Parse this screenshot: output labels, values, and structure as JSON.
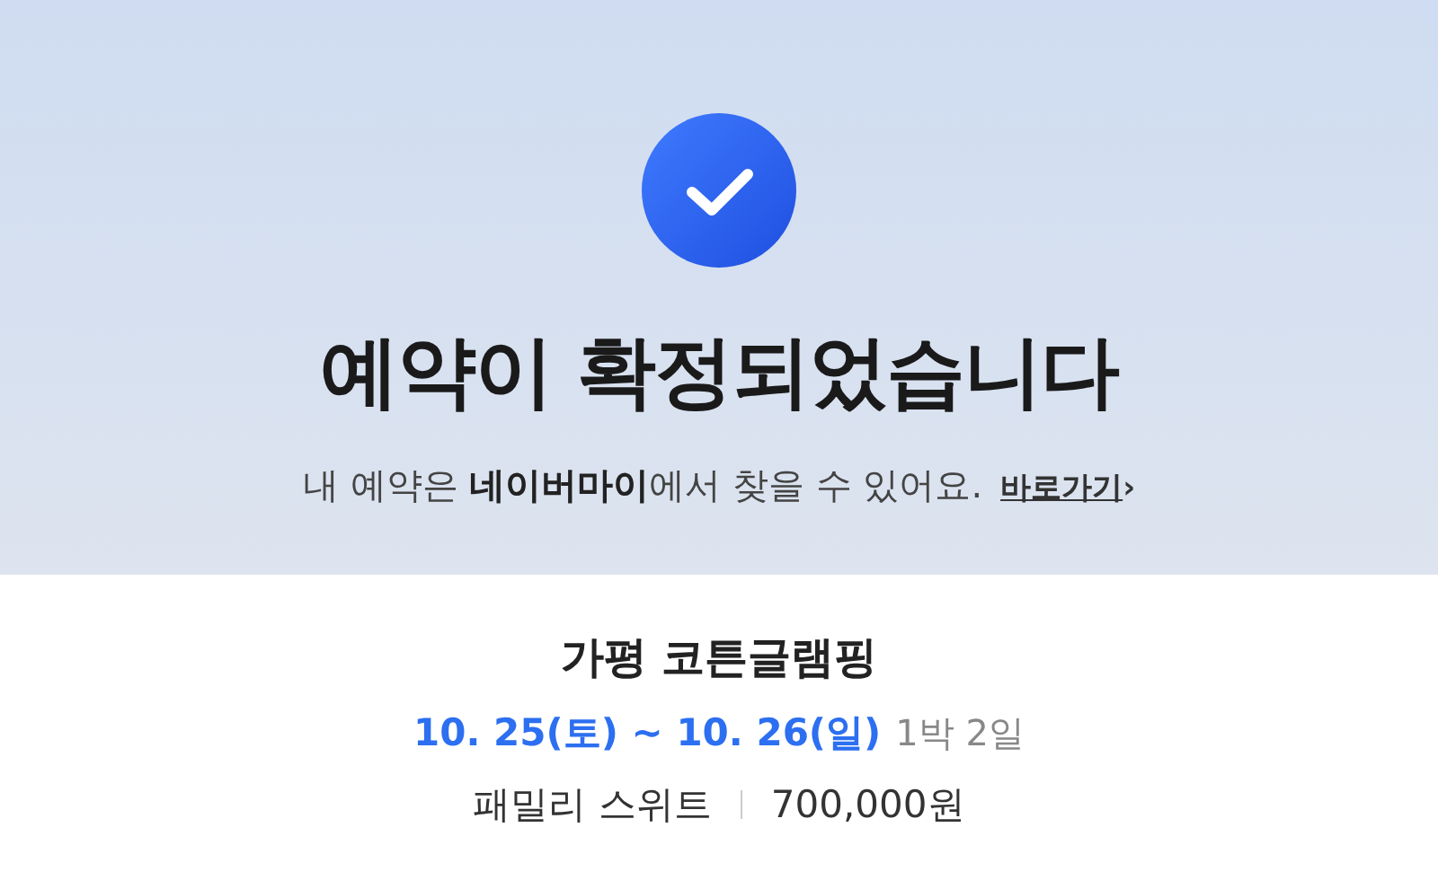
{
  "header": {
    "title": "예약이 확정되었습니다",
    "message": "내 예약은 **네이버마이**에서 찾을 수 있어요.",
    "link": "바로가기",
    "link_arrow": "›"
  },
  "booking": {
    "place": "가평 코튼글램핑",
    "dates": "10. 25(토) ~ 10. 26(일)",
    "duration": "1박 2일",
    "room": "패밀리 스위트",
    "price": "700,000원"
  }
}
